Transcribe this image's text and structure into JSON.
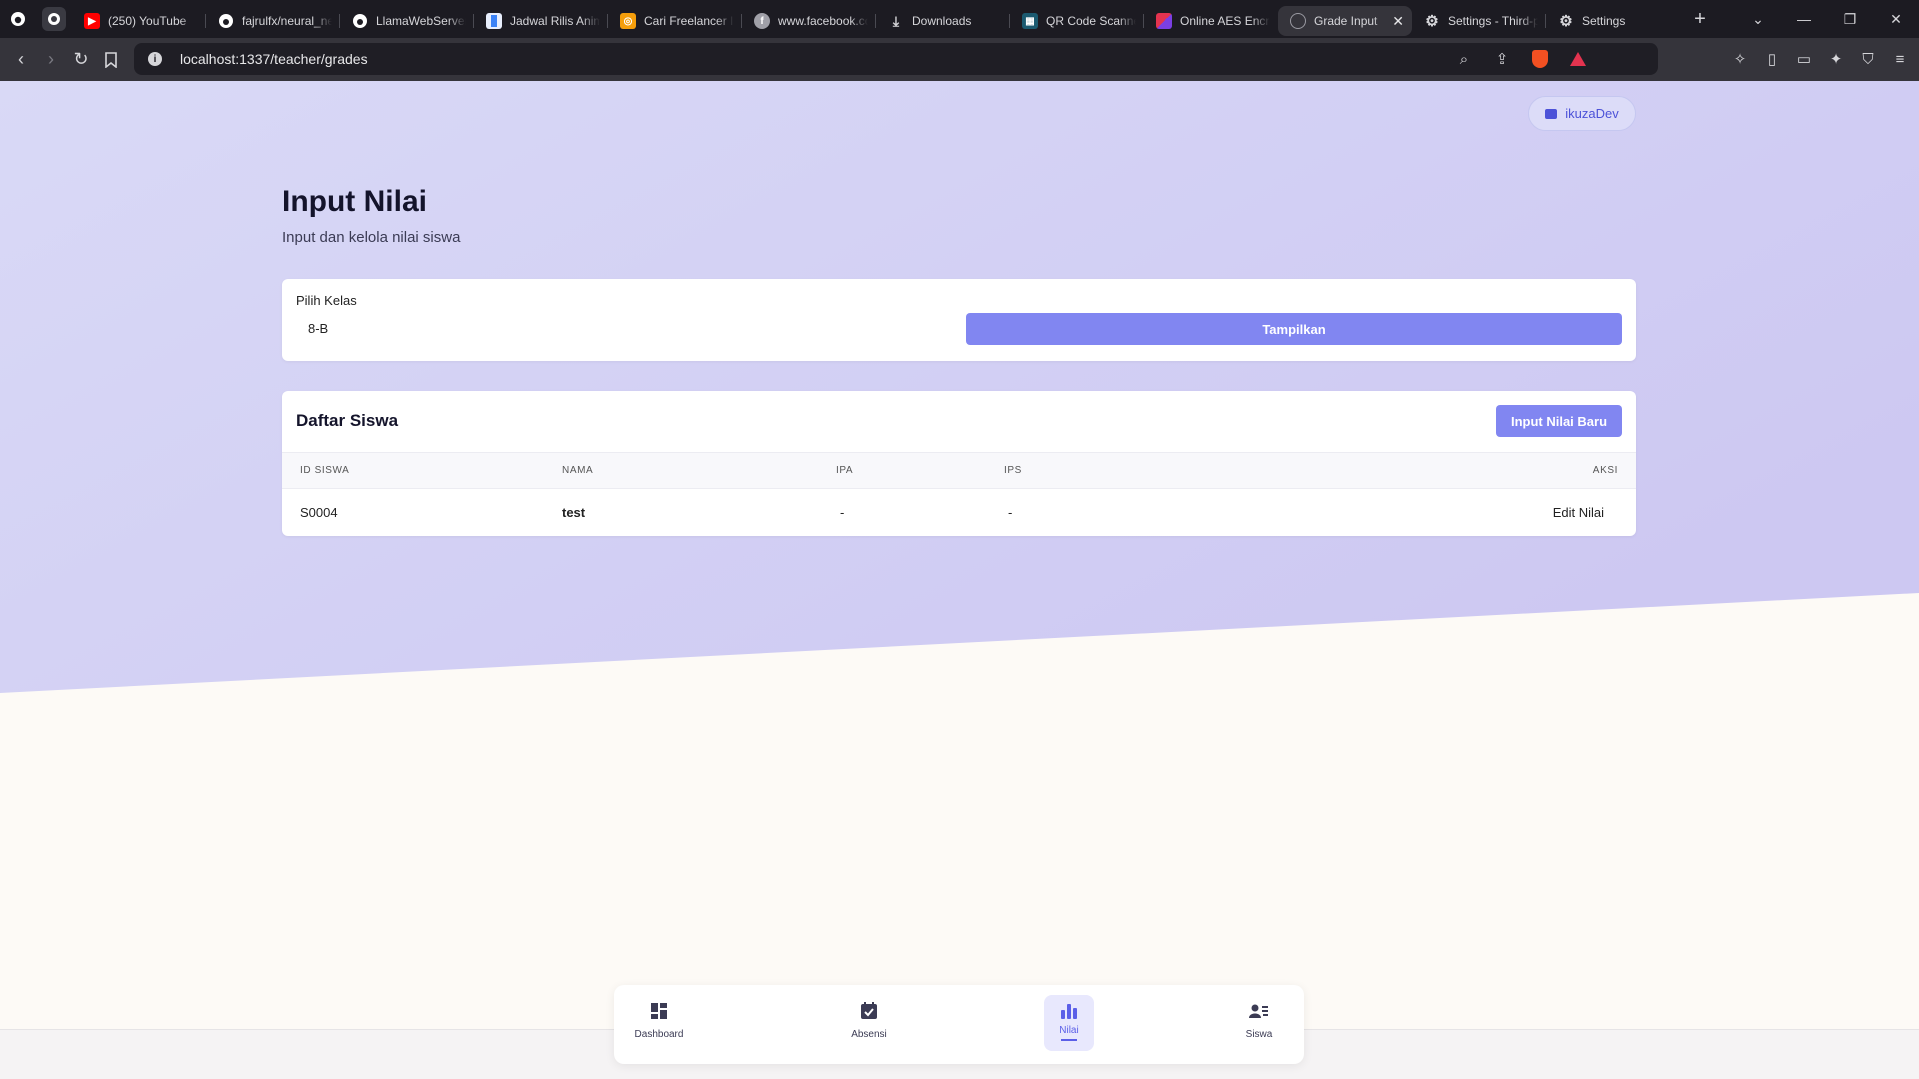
{
  "browser": {
    "tabs": [
      {
        "title": "(250) YouTube",
        "icon": "youtube-icon",
        "color": "#ff0000"
      },
      {
        "title": "fajrulfx/neural_network",
        "icon": "github-icon",
        "color": "#ffffff"
      },
      {
        "title": "LlamaWebServer",
        "icon": "github-icon",
        "color": "#ffffff"
      },
      {
        "title": "Jadwal Rilis Anime",
        "icon": "page-icon",
        "color": "#3b82f6"
      },
      {
        "title": "Cari Freelancer Indonesia",
        "icon": "freelancer-icon",
        "color": "#f59e0b"
      },
      {
        "title": "www.facebook.com",
        "icon": "facebook-icon",
        "color": "#a0a0a8"
      },
      {
        "title": "Downloads",
        "icon": "download-icon",
        "color": "#d6d6da"
      },
      {
        "title": "QR Code Scanner",
        "icon": "qr-icon",
        "color": "#22a0c8"
      },
      {
        "title": "Online AES Encryption",
        "icon": "aes-icon",
        "color": "#e3334f"
      },
      {
        "title": "Grade Input",
        "icon": "globe-icon",
        "color": "#6a6a74",
        "active": true
      },
      {
        "title": "Settings - Third-party",
        "icon": "gear-icon",
        "color": "#d6d6da"
      },
      {
        "title": "Settings",
        "icon": "gear-icon",
        "color": "#d6d6da"
      }
    ],
    "url": "localhost:1337/teacher/grades"
  },
  "header": {
    "profile_name": "ikuzaDev",
    "title": "Input Nilai",
    "subtitle": "Input dan kelola nilai siswa"
  },
  "filter": {
    "label": "Pilih Kelas",
    "selected_class": "8-B",
    "show_button": "Tampilkan"
  },
  "students": {
    "heading": "Daftar Siswa",
    "new_button": "Input Nilai Baru",
    "columns": [
      "ID SISWA",
      "NAMA",
      "IPA",
      "IPS",
      "AKSI"
    ],
    "rows": [
      {
        "id": "S0004",
        "name": "test",
        "ipa": "-",
        "ips": "-",
        "action": "Edit Nilai"
      }
    ]
  },
  "bottom_nav": {
    "items": [
      {
        "label": "Dashboard",
        "icon": "dashboard-icon"
      },
      {
        "label": "Absensi",
        "icon": "calendar-check-icon"
      },
      {
        "label": "Nilai",
        "icon": "bar-chart-icon",
        "active": true
      },
      {
        "label": "Siswa",
        "icon": "users-list-icon"
      }
    ]
  },
  "colors": {
    "accent": "#8186f1",
    "accent_dark": "#5b5fe8",
    "hero_bg": "#d8d6f6"
  }
}
